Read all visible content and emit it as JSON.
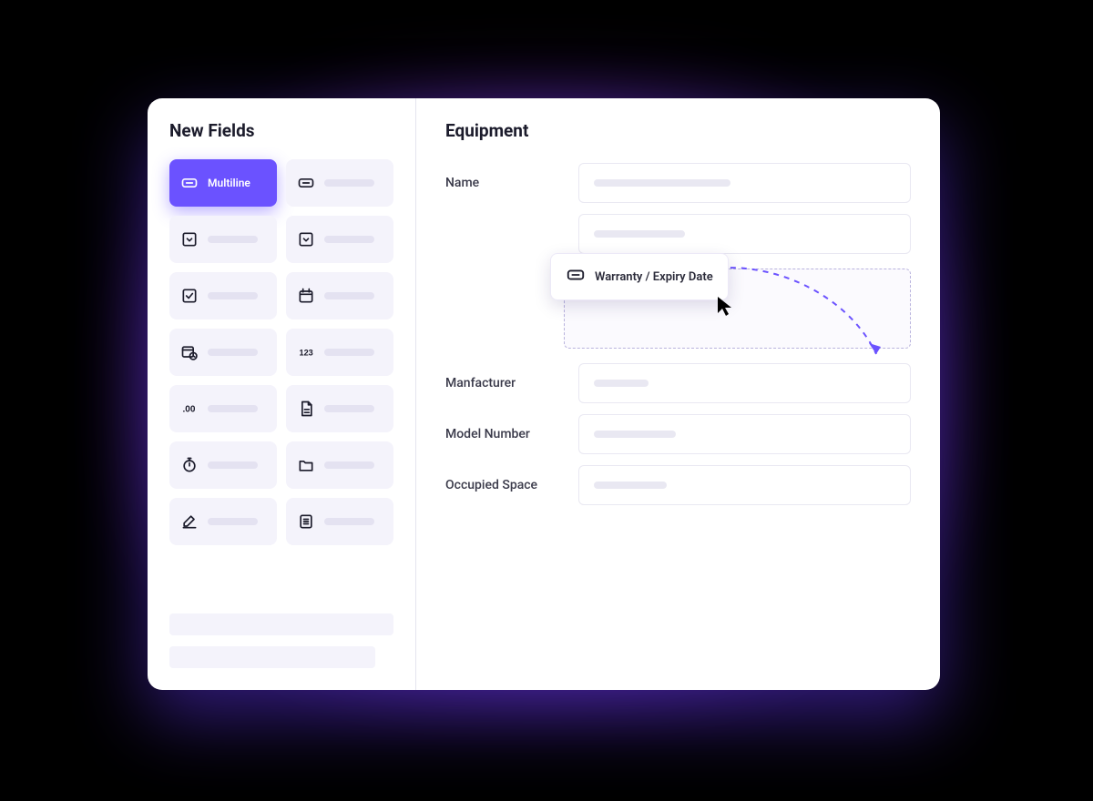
{
  "sidebar": {
    "title": "New Fields",
    "tiles": [
      {
        "label": "Multiline",
        "selected": true,
        "icon": "text-box"
      },
      {
        "icon": "text-box"
      },
      {
        "icon": "dropdown"
      },
      {
        "icon": "dropdown"
      },
      {
        "icon": "checkbox"
      },
      {
        "icon": "calendar"
      },
      {
        "icon": "calendar-clock"
      },
      {
        "icon": "number"
      },
      {
        "icon": "decimal"
      },
      {
        "icon": "file"
      },
      {
        "icon": "timer"
      },
      {
        "icon": "folder"
      },
      {
        "icon": "edit"
      },
      {
        "icon": "list"
      }
    ]
  },
  "main": {
    "title": "Equipment",
    "rows": [
      {
        "label": "Name",
        "skeleton_width": 150
      },
      {
        "label": "",
        "skeleton_width": 100
      },
      {
        "dropzone": true
      },
      {
        "label": "Manfacturer",
        "skeleton_width": 60
      },
      {
        "label": "Model Number",
        "skeleton_width": 90
      },
      {
        "label": "Occupied Space",
        "skeleton_width": 80
      }
    ]
  },
  "drag_chip": {
    "label": "Warranty / Expiry Date",
    "icon": "text-box"
  },
  "colors": {
    "accent": "#6b52ff"
  }
}
